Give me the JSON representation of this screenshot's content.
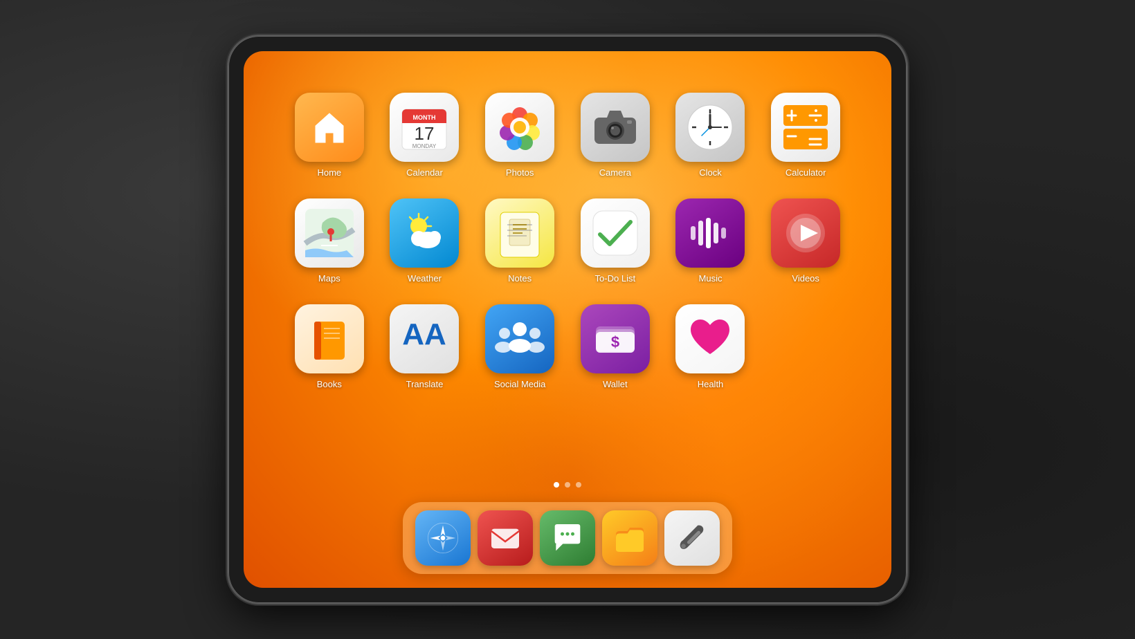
{
  "apps": [
    {
      "id": "home",
      "label": "Home",
      "bg": "bg-orange",
      "icon": "🏠"
    },
    {
      "id": "calendar",
      "label": "Calendar",
      "bg": "bg-white",
      "icon": "calendar"
    },
    {
      "id": "photos",
      "label": "Photos",
      "bg": "bg-white",
      "icon": "photos"
    },
    {
      "id": "camera",
      "label": "Camera",
      "bg": "bg-gray2",
      "icon": "camera"
    },
    {
      "id": "clock",
      "label": "Clock",
      "bg": "bg-gray2",
      "icon": "clock"
    },
    {
      "id": "calculator",
      "label": "Calculator",
      "bg": "bg-white",
      "icon": "calculator"
    },
    {
      "id": "maps",
      "label": "Maps",
      "bg": "bg-white",
      "icon": "maps"
    },
    {
      "id": "weather",
      "label": "Weather",
      "bg": "bg-blue",
      "icon": "weather"
    },
    {
      "id": "notes",
      "label": "Notes",
      "bg": "bg-notes",
      "icon": "notes"
    },
    {
      "id": "todo",
      "label": "To-Do List",
      "bg": "bg-todo",
      "icon": "todo"
    },
    {
      "id": "music",
      "label": "Music",
      "bg": "bg-purple",
      "icon": "music"
    },
    {
      "id": "videos",
      "label": "Videos",
      "bg": "bg-red",
      "icon": "videos"
    },
    {
      "id": "books",
      "label": "Books",
      "bg": "bg-books",
      "icon": "books"
    },
    {
      "id": "translate",
      "label": "Translate",
      "bg": "bg-translate",
      "icon": "translate"
    },
    {
      "id": "social",
      "label": "Social Media",
      "bg": "bg-socialblue",
      "icon": "social"
    },
    {
      "id": "wallet",
      "label": "Wallet",
      "bg": "bg-wallet",
      "icon": "wallet"
    },
    {
      "id": "health",
      "label": "Health",
      "bg": "bg-health",
      "icon": "health"
    }
  ],
  "dock": [
    {
      "id": "compass",
      "label": "Compass",
      "bg": "bg-compass"
    },
    {
      "id": "mail",
      "label": "Mail",
      "bg": "bg-mail"
    },
    {
      "id": "messages",
      "label": "Messages",
      "bg": "bg-messages"
    },
    {
      "id": "files",
      "label": "Files",
      "bg": "bg-files"
    },
    {
      "id": "tools",
      "label": "Tools",
      "bg": "bg-tools"
    }
  ],
  "calendar_day": "17",
  "calendar_month": "MONTH",
  "calendar_weekday": "MONDAY"
}
